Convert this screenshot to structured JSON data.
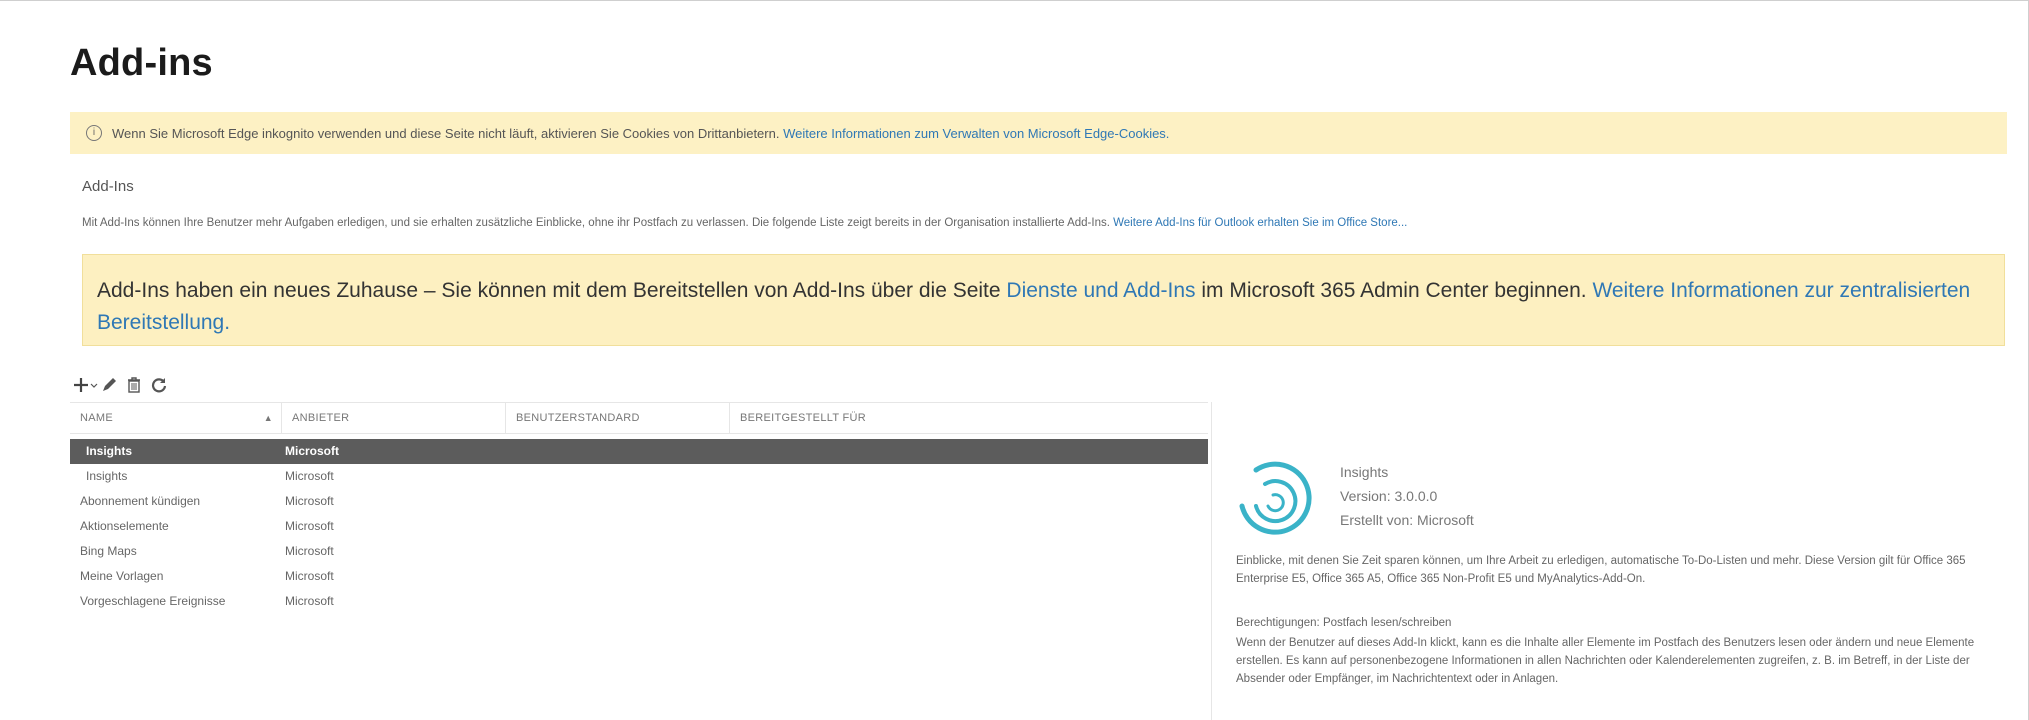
{
  "page": {
    "title": "Add-ins"
  },
  "banner_small": {
    "text": "Wenn Sie Microsoft Edge inkognito verwenden und diese Seite nicht läuft, aktivieren Sie Cookies von Drittanbietern.",
    "link": "Weitere Informationen zum Verwalten von Microsoft Edge-Cookies."
  },
  "section": {
    "label": "Add-Ins",
    "desc": "Mit Add-Ins können Ihre Benutzer mehr Aufgaben erledigen, und sie erhalten zusätzliche Einblicke, ohne ihr Postfach zu verlassen. Die folgende Liste zeigt bereits in der Organisation installierte Add-Ins.",
    "desc_link": "Weitere Add-Ins für Outlook erhalten Sie im Office Store..."
  },
  "banner_big": {
    "text1": "Add-Ins haben ein neues Zuhause – Sie können mit dem Bereitstellen von Add-Ins über die Seite",
    "link1": "Dienste und Add-Ins",
    "text2": "im Microsoft 365 Admin Center beginnen.",
    "link2": "Weitere Informationen zur zentralisierten Bereitstellung."
  },
  "toolbar": {
    "icons": [
      "add-icon",
      "dropdown-chevron-icon",
      "edit-pencil-icon",
      "delete-trash-icon",
      "refresh-icon"
    ]
  },
  "table": {
    "columns": [
      "NAME",
      "ANBIETER",
      "BENUTZERSTANDARD",
      "BEREITGESTELLT FÜR"
    ],
    "rows": [
      {
        "name": "Insights",
        "provider": "Microsoft"
      },
      {
        "name": "Insights",
        "provider": "Microsoft"
      },
      {
        "name": "Abonnement kündigen",
        "provider": "Microsoft"
      },
      {
        "name": "Aktionselemente",
        "provider": "Microsoft"
      },
      {
        "name": "Bing Maps",
        "provider": "Microsoft"
      },
      {
        "name": "Meine Vorlagen",
        "provider": "Microsoft"
      },
      {
        "name": "Vorgeschlagene Ereignisse",
        "provider": "Microsoft"
      }
    ],
    "selected_row": "Insights"
  },
  "detail": {
    "name": "Insights",
    "version": "Version: 3.0.0.0",
    "created_by": "Erstellt von: Microsoft",
    "description": "Einblicke, mit denen Sie Zeit sparen können, um Ihre Arbeit zu erledigen, automatische To-Do-Listen und mehr. Diese Version gilt für Office 365 Enterprise E5, Office 365 A5, Office 365 Non-Profit E5 und MyAnalytics-Add-On.",
    "permissions_title": "Berechtigungen: Postfach lesen/schreiben",
    "permissions_text": "Wenn der Benutzer auf dieses Add-In klickt, kann es die Inhalte aller Elemente im Postfach des Benutzers lesen oder ändern und neue Elemente erstellen. Es kann auf personenbezogene Informationen in allen Nachrichten oder Kalenderelementen zugreifen, z. B. im Betreff, in der Liste der Absender oder Empfänger, im Nachrichtentext oder in Anlagen."
  },
  "colors": {
    "banner_bg": "#fdf1c4",
    "link": "#2f78b5",
    "selected_row_bg": "#5c5c5c",
    "logo": "#3ab3c8"
  }
}
